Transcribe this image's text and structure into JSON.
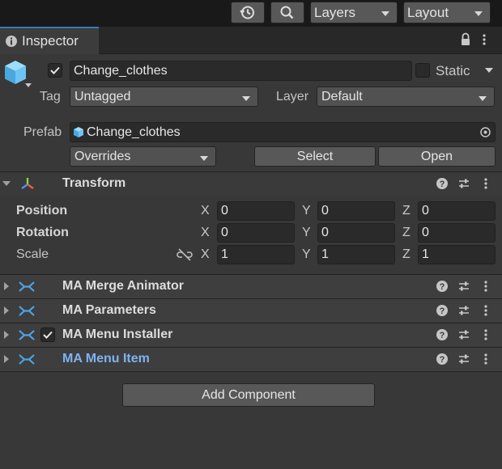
{
  "toolbar": {
    "layers_label": "Layers",
    "layout_label": "Layout",
    "icons": [
      "history-icon",
      "search-icon"
    ]
  },
  "tab": {
    "title": "Inspector"
  },
  "object": {
    "active": true,
    "name": "Change_clothes",
    "static_label": "Static",
    "static_checked": false,
    "tag_label": "Tag",
    "tag_value": "Untagged",
    "layer_label": "Layer",
    "layer_value": "Default"
  },
  "prefab": {
    "label": "Prefab",
    "asset": "Change_clothes",
    "overrides_label": "Overrides",
    "select_label": "Select",
    "open_label": "Open"
  },
  "transform": {
    "title": "Transform",
    "rows": [
      {
        "label": "Position",
        "x": "0",
        "y": "0",
        "z": "0"
      },
      {
        "label": "Rotation",
        "x": "0",
        "y": "0",
        "z": "0"
      },
      {
        "label": "Scale",
        "x": "1",
        "y": "1",
        "z": "1"
      }
    ],
    "axes": {
      "x": "X",
      "y": "Y",
      "z": "Z"
    }
  },
  "components": [
    {
      "title": "MA Merge Animator"
    },
    {
      "title": "MA Parameters"
    },
    {
      "title": "MA Menu Installer",
      "enabled": true
    },
    {
      "title": "MA Menu Item",
      "accent": "#7fb2f0"
    }
  ],
  "add_component_label": "Add Component",
  "colors": {
    "accent_blue": "#3a79bb",
    "ma_icon": "#4ea3e6",
    "cube_icon": "#6cc5f5",
    "menu_item_title": "#7fb2f0"
  }
}
